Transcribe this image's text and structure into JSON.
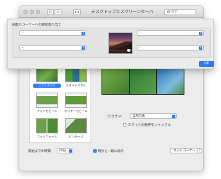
{
  "window": {
    "title": "デスクトップとスクリーンセーバ",
    "search_placeholder": "検索",
    "nav_back": "<",
    "nav_forward": ">"
  },
  "sheet": {
    "title": "画面のコーナーへの機能割り当て",
    "corners": {
      "top_left": "-",
      "top_right": "-",
      "bottom_left": "-",
      "bottom_right": "-"
    },
    "ok_label": "OK"
  },
  "screensavers": [
    {
      "label": "シフトタイル",
      "selected": true
    },
    {
      "label": "スライドパネル",
      "selected": false
    },
    {
      "label": "フォトモビール",
      "selected": false
    },
    {
      "label": "ホリデーモビール",
      "selected": false
    },
    {
      "label": "フォトウォール",
      "selected": false
    },
    {
      "label": "ビンテージ",
      "selected": false
    }
  ],
  "source": {
    "label": "ピクチャ:",
    "value": "自然写真"
  },
  "shuffle_label": "スライドの順序をシャッフル",
  "bottom": {
    "start_label": "開始までの時間:",
    "start_value": "20分",
    "clock_label": "時計と一緒に表示",
    "clock_checked": true,
    "hot_corners_label": "ホットコーナー...",
    "help_label": "?"
  },
  "colors": {
    "accent": "#2e7cf6"
  }
}
